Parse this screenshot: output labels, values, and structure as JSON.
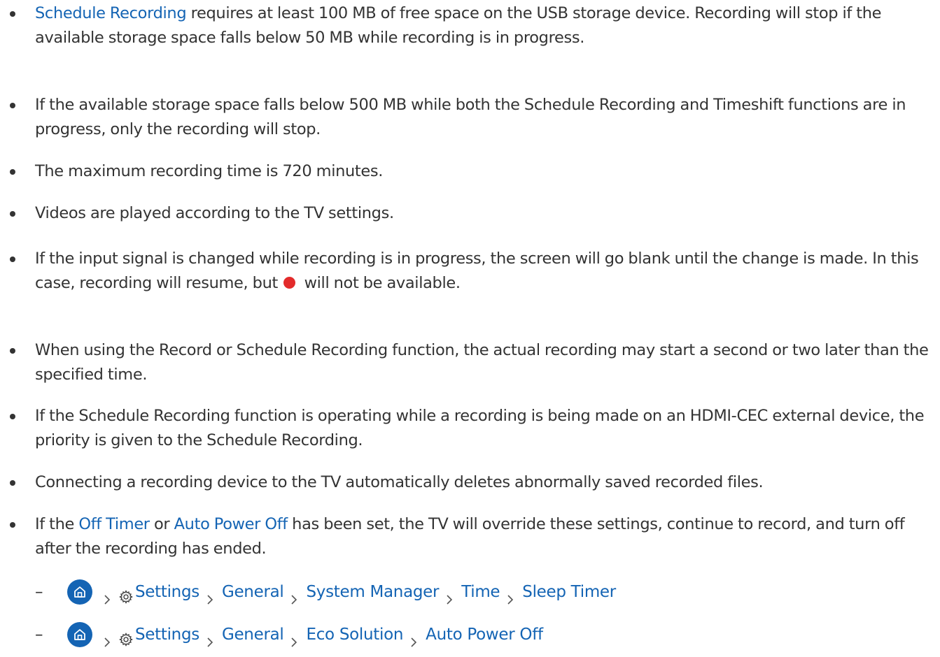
{
  "notes": [
    {
      "parts": [
        {
          "text": "Schedule Recording",
          "link": true
        },
        {
          "text": " requires at least 100 MB of free space on the USB storage device. Recording will stop if the available storage space falls below 50 MB while recording is in progress.",
          "link": false
        }
      ]
    },
    {
      "parts": [
        {
          "text": "If the available storage space falls below 500 MB while both the Schedule Recording and Timeshift functions are in progress, only the recording will stop.",
          "link": false
        }
      ]
    },
    {
      "parts": [
        {
          "text": "The maximum recording time is 720 minutes.",
          "link": false
        }
      ]
    },
    {
      "parts": [
        {
          "text": "Videos are played according to the TV settings.",
          "link": false
        }
      ]
    },
    {
      "parts": [
        {
          "text": "If the input signal is changed while recording is in progress, the screen will go blank until the change is made. In this case, recording will resume, but ",
          "link": false
        },
        {
          "record_icon": true
        },
        {
          "text": " will not be available.",
          "link": false
        }
      ]
    },
    {
      "parts": [
        {
          "text": "When using the Record or Schedule Recording function, the actual recording may start a second or two later than the specified time.",
          "link": false
        }
      ]
    },
    {
      "parts": [
        {
          "text": "If the Schedule Recording function is operating while a recording is being made on an HDMI-CEC external device, the priority is given to the Schedule Recording.",
          "link": false
        }
      ]
    },
    {
      "parts": [
        {
          "text": "Connecting a recording device to the TV automatically deletes abnormally saved recorded files.",
          "link": false
        }
      ]
    },
    {
      "parts": [
        {
          "text": "If the ",
          "link": false
        },
        {
          "text": "Off Timer",
          "link": true
        },
        {
          "text": " or ",
          "link": false
        },
        {
          "text": "Auto Power Off",
          "link": true
        },
        {
          "text": " has been set, the TV will override these settings, continue to record, and turn off after the recording has ended.",
          "link": false
        }
      ]
    }
  ],
  "paths": [
    {
      "dash": "–",
      "crumbs": [
        "Settings",
        "General",
        "System Manager",
        "Time",
        "Sleep Timer"
      ]
    },
    {
      "dash": "–",
      "crumbs": [
        "Settings",
        "General",
        "Eco Solution",
        "Auto Power Off"
      ]
    }
  ],
  "colors": {
    "link": "#1464b4",
    "text": "#333333",
    "record_dot": "#e32b2b"
  }
}
